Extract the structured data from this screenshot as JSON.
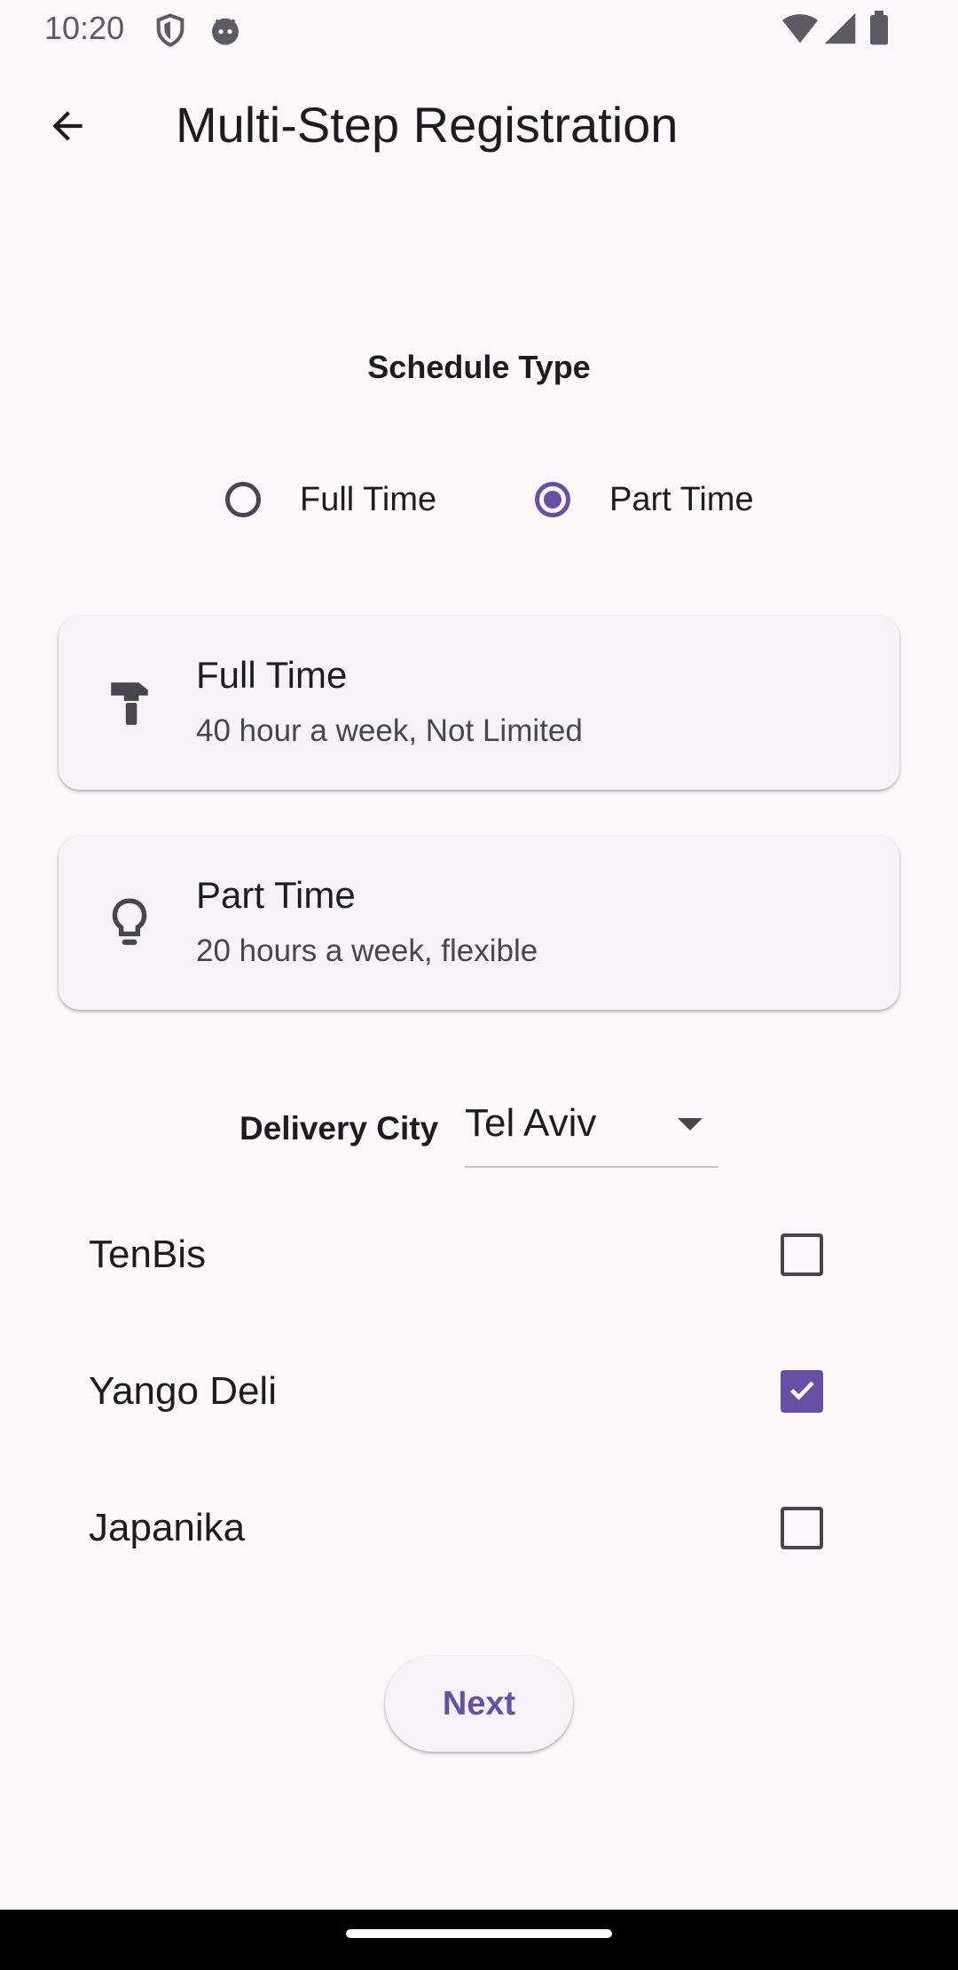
{
  "status_bar": {
    "time": "10:20",
    "left_icons": [
      "shield-icon",
      "android-face-icon"
    ],
    "right_icons": [
      "wifi-icon",
      "cell-signal-icon",
      "battery-icon"
    ]
  },
  "app_bar": {
    "back_icon": "arrow-back-icon",
    "title": "Multi-Step Registration"
  },
  "schedule": {
    "title": "Schedule Type",
    "options": [
      {
        "label": "Full Time",
        "selected": false
      },
      {
        "label": "Part Time",
        "selected": true
      }
    ]
  },
  "cards": [
    {
      "icon": "hammer-icon",
      "title": "Full Time",
      "subtitle": "40 hour a week, Not Limited"
    },
    {
      "icon": "lightbulb-icon",
      "title": "Part Time",
      "subtitle": "20 hours a week, flexible"
    }
  ],
  "city": {
    "label": "Delivery City",
    "value": "Tel Aviv"
  },
  "companies": [
    {
      "label": "TenBis",
      "checked": false
    },
    {
      "label": "Yango Deli",
      "checked": true
    },
    {
      "label": "Japanika",
      "checked": false
    }
  ],
  "next_button": {
    "label": "Next"
  },
  "colors": {
    "background": "#FDF7FC",
    "accent": "#6750A4",
    "card": "#F7F2F7"
  }
}
